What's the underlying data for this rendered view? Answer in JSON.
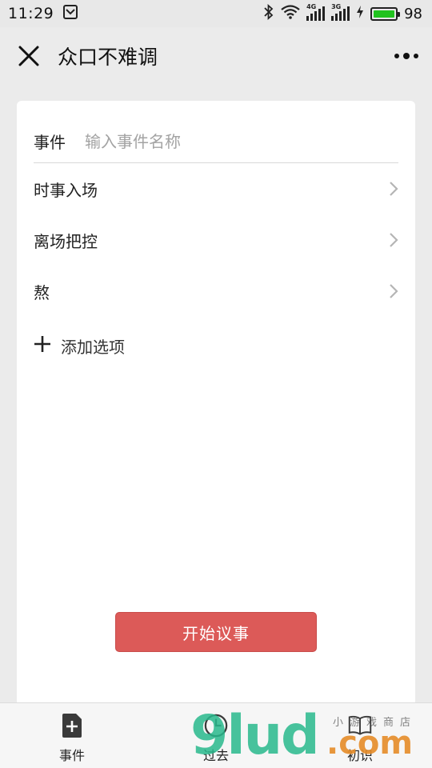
{
  "status_bar": {
    "time": "11:29",
    "net_1": "4G",
    "net_2": "3G",
    "battery_pct": "98",
    "battery_level": 0.98
  },
  "nav": {
    "title": "众口不难调"
  },
  "form": {
    "event_label": "事件",
    "event_placeholder": "输入事件名称",
    "event_value": "",
    "options": [
      {
        "label": "时事入场"
      },
      {
        "label": "离场把控"
      },
      {
        "label": "熬"
      }
    ],
    "add_option_label": "添加选项",
    "start_label": "开始议事"
  },
  "tabs": [
    {
      "label": "事件",
      "icon": "document-plus-icon"
    },
    {
      "label": "过去",
      "icon": "clock-icon"
    },
    {
      "label": "初识",
      "icon": "book-icon"
    }
  ],
  "watermark": {
    "main": "9lud",
    "suffix": ".com",
    "cn": "小游戏商店"
  },
  "colors": {
    "accent": "#dc5a58",
    "battery": "#21c21e",
    "background": "#ebebeb"
  }
}
